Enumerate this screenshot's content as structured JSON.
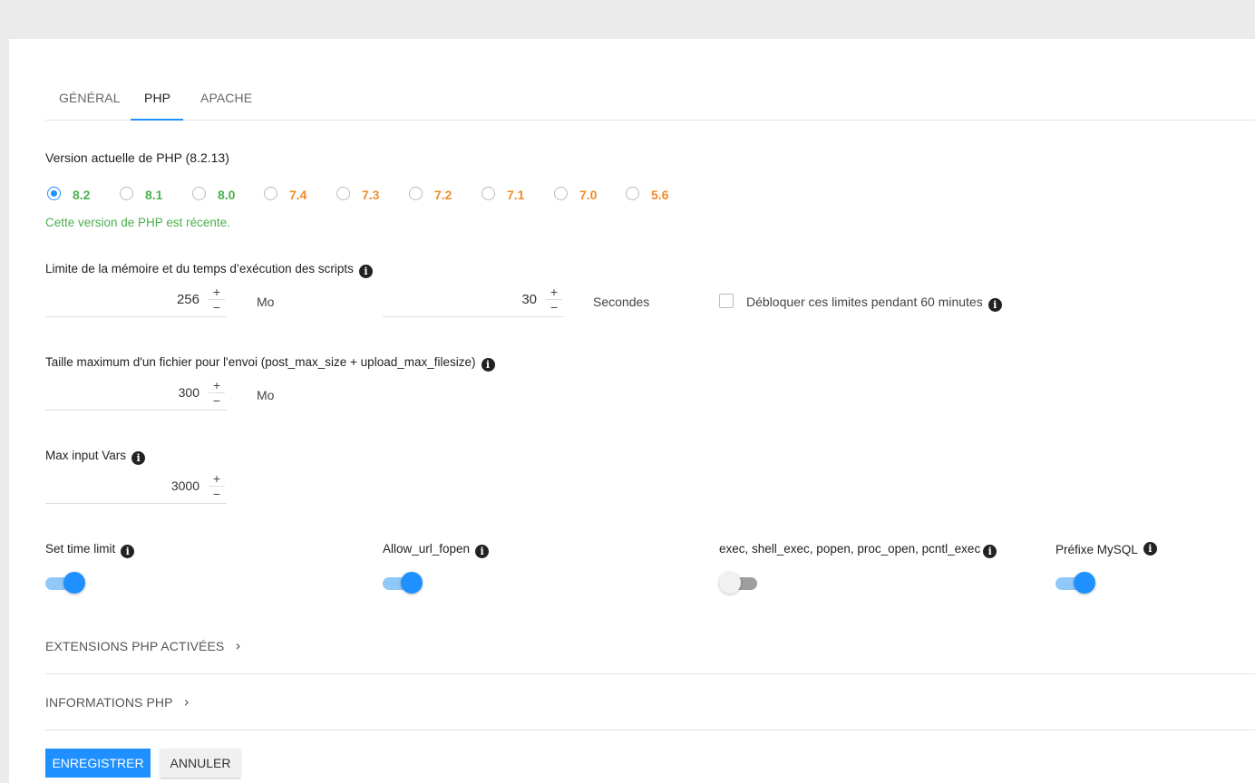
{
  "tabs": [
    "GÉNÉRAL",
    "PHP",
    "APACHE"
  ],
  "php_version": {
    "label": "Version actuelle de PHP (8.2.13)",
    "options": [
      "8.2",
      "8.1",
      "8.0",
      "7.4",
      "7.3",
      "7.2",
      "7.1",
      "7.0",
      "5.6"
    ],
    "selected": "8.2",
    "status": "Cette version de PHP est récente.",
    "colors": {
      "recent": "#4caf50",
      "old": "#f08c28"
    }
  },
  "limits": {
    "label": "Limite de la mémoire et du temps d’exécution des scripts",
    "memory_value": "256",
    "memory_unit": "Mo",
    "time_value": "30",
    "time_unit": "Secondes",
    "unlock_label": "Débloquer ces limites pendant 60 minutes"
  },
  "upload": {
    "label": "Taille maximum d'un fichier pour l'envoi (post_max_size + upload_max_filesize)",
    "value": "300",
    "unit": "Mo"
  },
  "max_input_vars": {
    "label": "Max input Vars",
    "value": "3000"
  },
  "toggles": [
    {
      "label": "Set time limit",
      "on": true
    },
    {
      "label": "Allow_url_fopen",
      "on": true
    },
    {
      "label": "exec, shell_exec, popen, proc_open, pcntl_exec",
      "on": false
    },
    {
      "label": "Préfixe MySQL",
      "on": true
    }
  ],
  "sections": {
    "extensions": "EXTENSIONS PHP ACTIVÉES",
    "info": "INFORMATIONS PHP"
  },
  "buttons": {
    "save": "ENREGISTRER",
    "cancel": "ANNULER"
  },
  "icons": {
    "info": "info-icon",
    "chevron": "chevron-right-icon",
    "plus": "plus-icon",
    "minus": "minus-icon"
  },
  "accent_color": "#1e90ff"
}
